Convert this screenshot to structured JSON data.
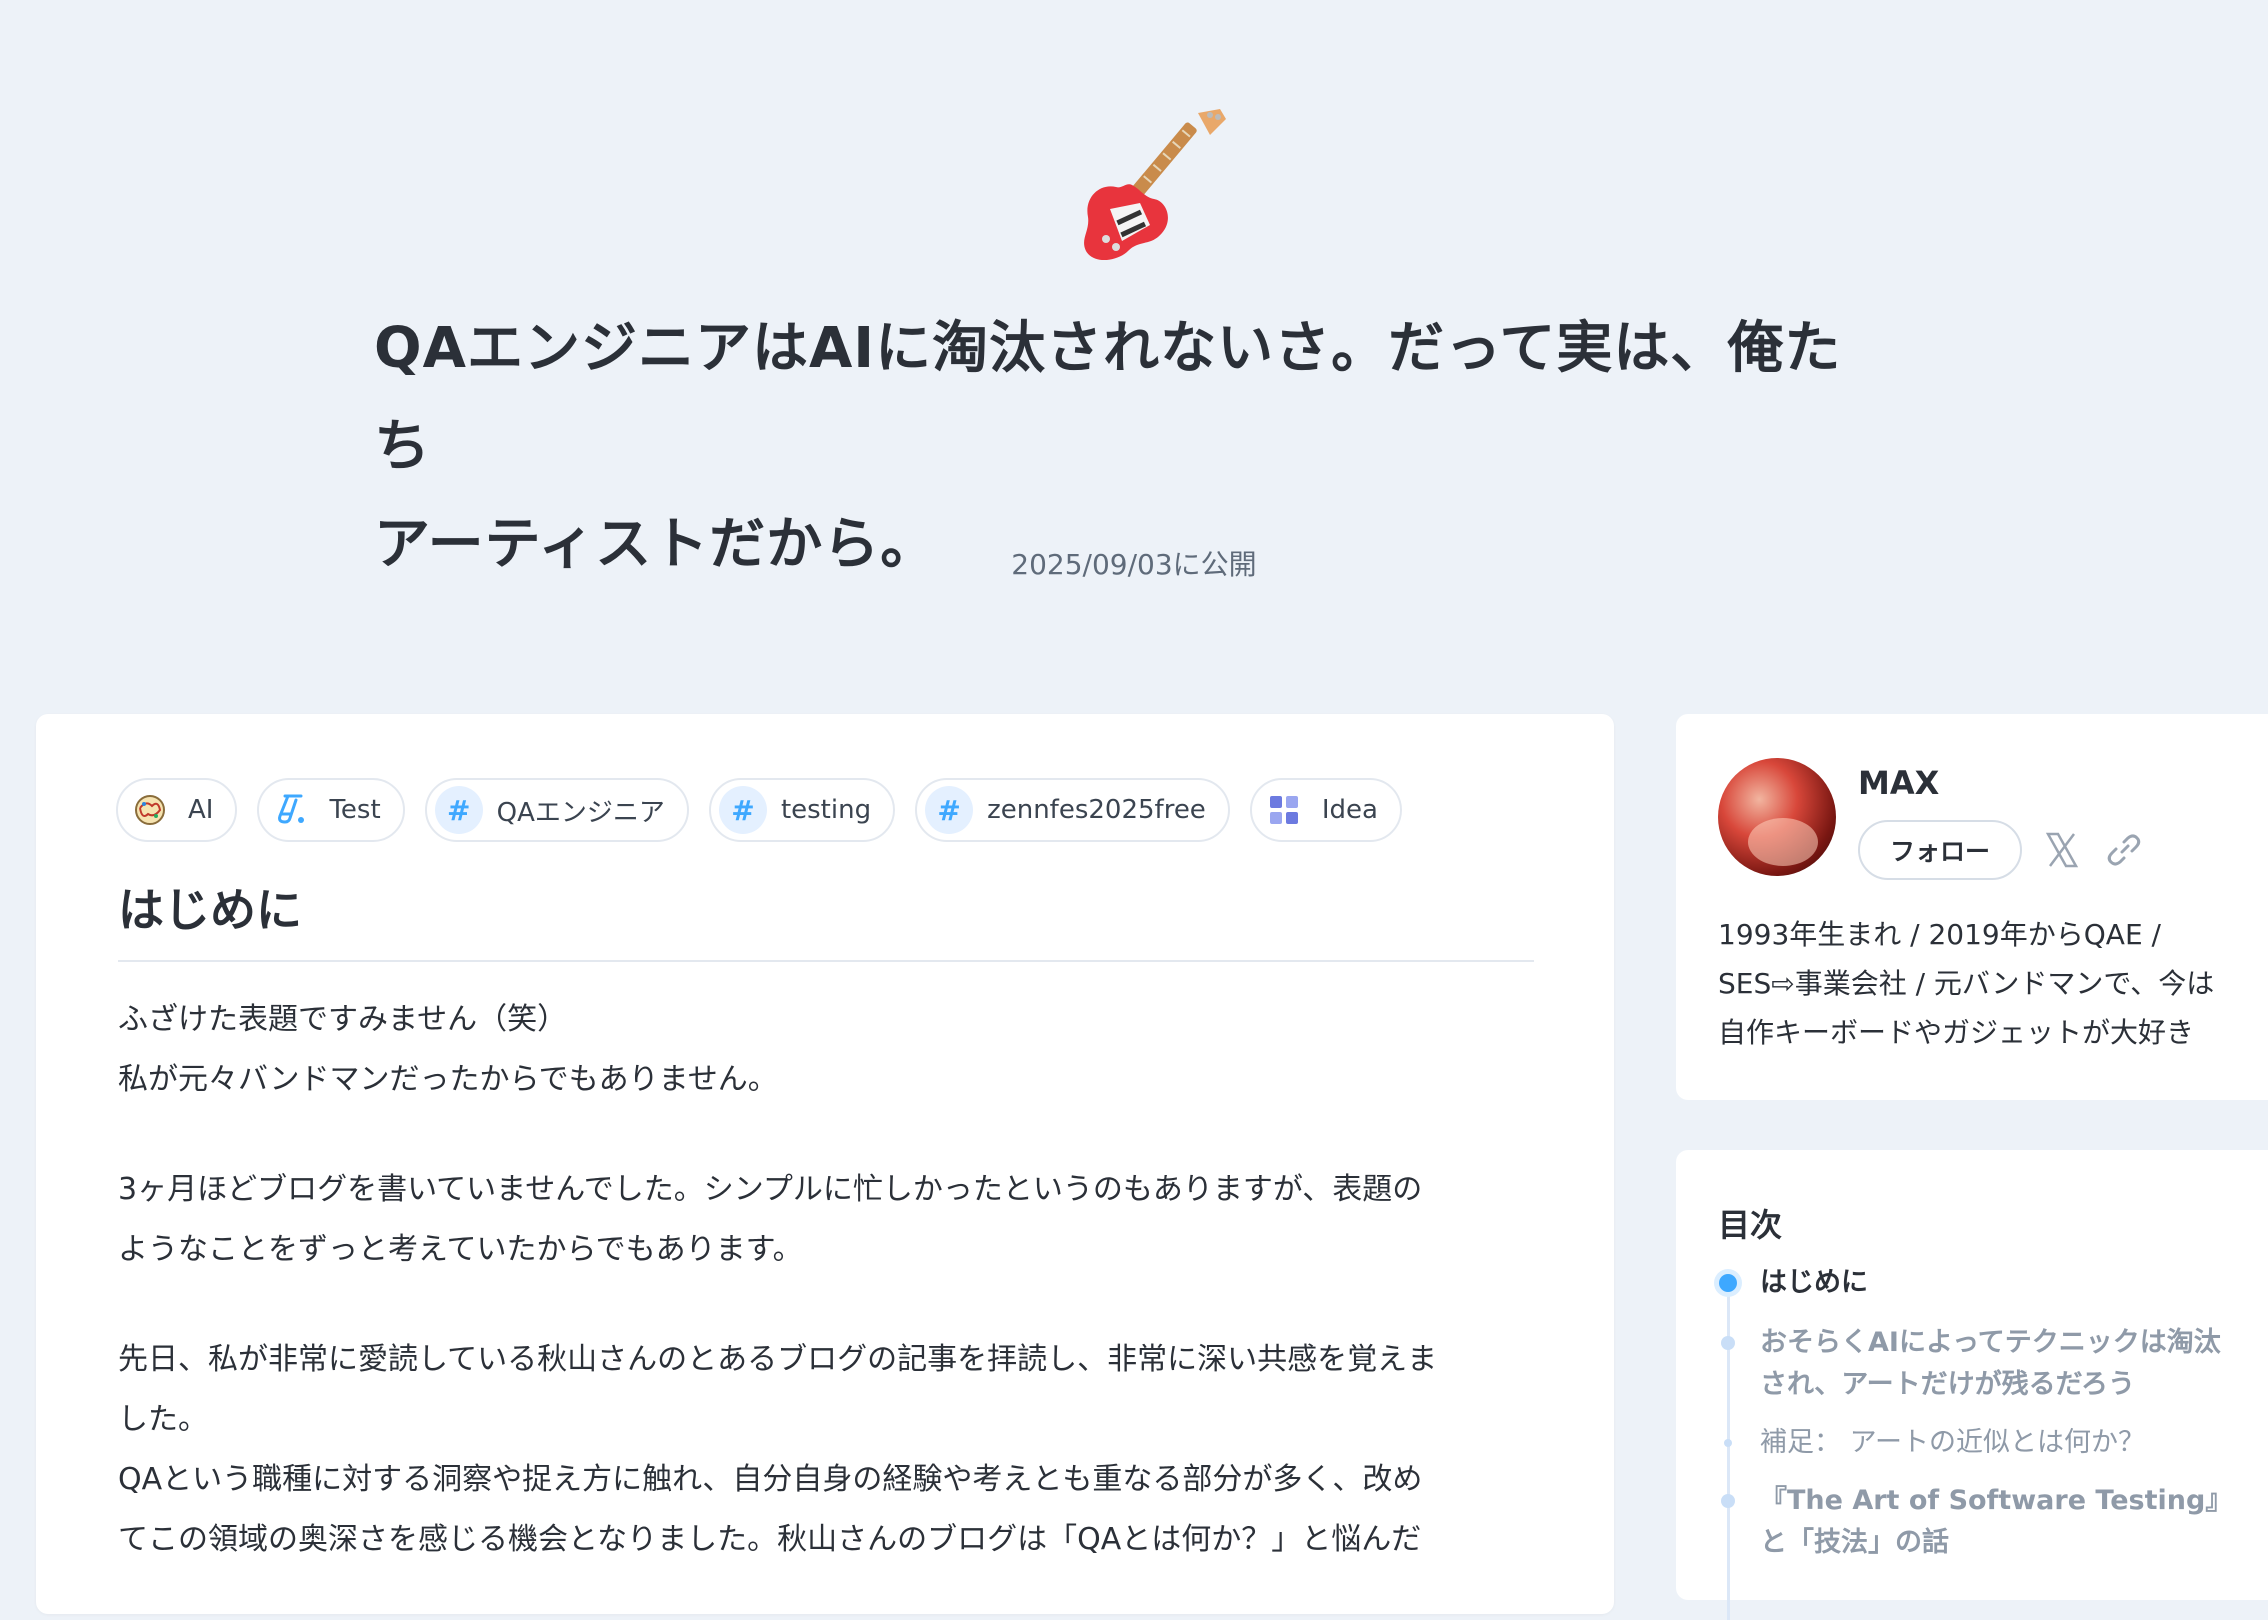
{
  "header": {
    "emoji_icon": "guitar-icon",
    "title_line1": "QAエンジニアはAIに淘汰されないさ。だって実は、俺たち",
    "title_line2": "アーティストだから。",
    "published": "2025/09/03に公開"
  },
  "topics": [
    {
      "label": "AI",
      "icon": "brain-icon"
    },
    {
      "label": "Test",
      "icon": "test-tube-icon"
    },
    {
      "label": "QAエンジニア",
      "icon": "hash-icon"
    },
    {
      "label": "testing",
      "icon": "hash-icon"
    },
    {
      "label": "zennfes2025free",
      "icon": "hash-icon"
    },
    {
      "label": "Idea",
      "icon": "grid-icon"
    }
  ],
  "article": {
    "heading": "はじめに",
    "p1_l1": "ふざけた表題ですみません（笑）",
    "p1_l2": "私が元々バンドマンだったからでもありません。",
    "p2_l1": "3ヶ月ほどブログを書いていませんでした。シンプルに忙しかったというのもありますが、表題の",
    "p2_l2": "ようなことをずっと考えていたからでもあります。",
    "p3_l1": "先日、私が非常に愛読している秋山さんのとあるブログの記事を拝読し、非常に深い共感を覚えま",
    "p3_l2": "した。",
    "p3_l3": "QAという職種に対する洞察や捉え方に触れ、自分自身の経験や考えとも重なる部分が多く、改め",
    "p3_l4": "てこの領域の奥深さを感じる機会となりました。秋山さんのブログは「QAとは何か？」と悩んだ"
  },
  "profile": {
    "name": "MAX",
    "follow_label": "フォロー",
    "bio_l1": "1993年生まれ / 2019年からQAE /",
    "bio_l2": "SES⇨事業会社 / 元バンドマンで、今は",
    "bio_l3": "自作キーボードやガジェットが大好き"
  },
  "toc": {
    "title": "目次",
    "items": [
      {
        "label": "はじめに",
        "active": true
      },
      {
        "label": "おそらくAIによってテクニックは淘汰され、アートだけが残るだろう"
      },
      {
        "label": "補足： アートの近似とは何か？"
      },
      {
        "label": "『The Art of Software Testing』と「技法」の話"
      }
    ]
  },
  "colors": {
    "background": "#edf2f8",
    "accent": "#3ea8ff",
    "text": "#2b3038",
    "muted": "#8f9aa8"
  }
}
